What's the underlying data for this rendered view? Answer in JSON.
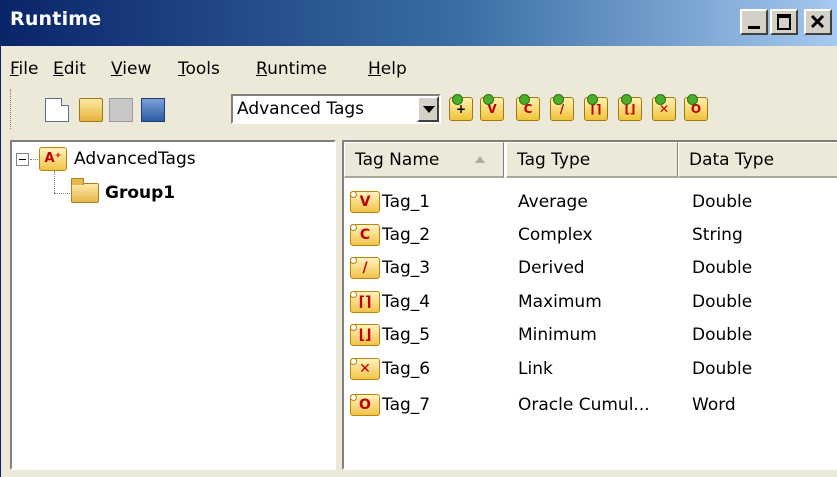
{
  "window": {
    "title": "Runtime"
  },
  "menu": [
    "File",
    "Edit",
    "View",
    "Tools",
    "Runtime",
    "Help"
  ],
  "menu_mnemonics": [
    "F",
    "E",
    "V",
    "T",
    "R",
    "H"
  ],
  "toolbar": {
    "combo_value": "Advanced Tags",
    "tag_buttons": [
      "add-tag",
      "average-tag",
      "complex-tag",
      "derived-tag",
      "maximum-tag",
      "minimum-tag",
      "link-tag",
      "oracle-tag"
    ]
  },
  "tree": {
    "root": {
      "label": "AdvancedTags",
      "icon": "advanced-tags-icon"
    },
    "children": [
      {
        "label": "Group1",
        "icon": "folder-icon"
      }
    ]
  },
  "list": {
    "columns": [
      "Tag Name",
      "Tag Type",
      "Data Type"
    ],
    "sorted_column": "Tag Name",
    "rows": [
      {
        "name": "Tag_1",
        "type": "Average",
        "data_type": "Double",
        "icon": "average-tag-icon"
      },
      {
        "name": "Tag_2",
        "type": "Complex",
        "data_type": "String",
        "icon": "complex-tag-icon"
      },
      {
        "name": "Tag_3",
        "type": "Derived",
        "data_type": "Double",
        "icon": "derived-tag-icon"
      },
      {
        "name": "Tag_4",
        "type": "Maximum",
        "data_type": "Double",
        "icon": "maximum-tag-icon"
      },
      {
        "name": "Tag_5",
        "type": "Minimum",
        "data_type": "Double",
        "icon": "minimum-tag-icon"
      },
      {
        "name": "Tag_6",
        "type": "Link",
        "data_type": "Double",
        "icon": "link-tag-icon"
      },
      {
        "name": "Tag_7",
        "type": "Oracle Cumul...",
        "data_type": "Word",
        "icon": "oracle-tag-icon"
      }
    ]
  },
  "colors": {
    "titlebar_start": "#0a246a",
    "titlebar_end": "#a6caf0",
    "chrome": "#ece9d8",
    "tag_glyph": "#c00000"
  }
}
